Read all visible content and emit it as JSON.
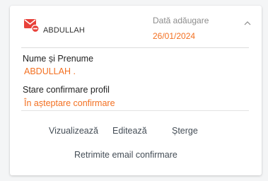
{
  "card": {
    "user_name": "ABDULLAH",
    "date_label": "Dată adăugare",
    "date_value": "26/01/2024"
  },
  "fields": {
    "name_label": "Nume și Prenume",
    "name_value": "ABDULLAH .",
    "status_label": "Stare confirmare profil",
    "status_value": "În așteptare confirmare"
  },
  "actions": {
    "view": "Vizualizează",
    "edit": "Editează",
    "delete": "Șterge",
    "resend": "Retrimite email confirmare"
  },
  "colors": {
    "accent": "#f37021",
    "icon_red": "#e8413a",
    "text": "#222222",
    "muted": "#8c8c8c"
  },
  "icons": {
    "mail_status": "mail-blocked-icon",
    "collapse": "chevron-up-icon"
  }
}
